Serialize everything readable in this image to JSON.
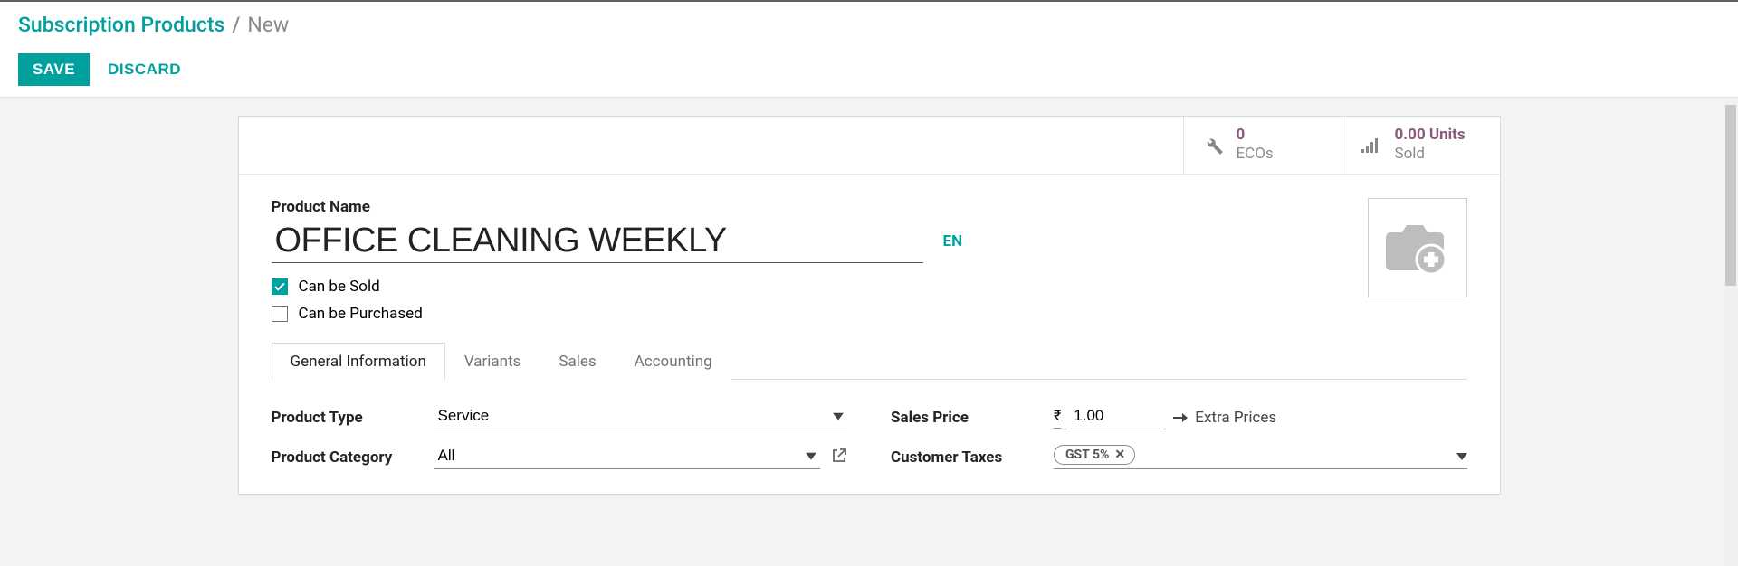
{
  "breadcrumb": {
    "parent": "Subscription Products",
    "sep": "/",
    "current": "New"
  },
  "actions": {
    "save": "SAVE",
    "discard": "DISCARD"
  },
  "stats": {
    "ecos": {
      "value": "0",
      "label": "ECOs"
    },
    "sold": {
      "value": "0.00 Units",
      "label": "Sold"
    }
  },
  "product": {
    "name_label": "Product Name",
    "name_value": "OFFICE CLEANING WEEKLY",
    "lang": "EN",
    "can_be_sold_label": "Can be Sold",
    "can_be_purchased_label": "Can be Purchased"
  },
  "tabs": [
    "General Information",
    "Variants",
    "Sales",
    "Accounting"
  ],
  "fields": {
    "product_type": {
      "label": "Product Type",
      "value": "Service"
    },
    "product_category": {
      "label": "Product Category",
      "value": "All"
    },
    "sales_price": {
      "label": "Sales Price",
      "currency": "₹",
      "value": "1.00"
    },
    "extra_prices": "Extra Prices",
    "customer_taxes": {
      "label": "Customer Taxes",
      "tag": "GST 5%"
    }
  }
}
